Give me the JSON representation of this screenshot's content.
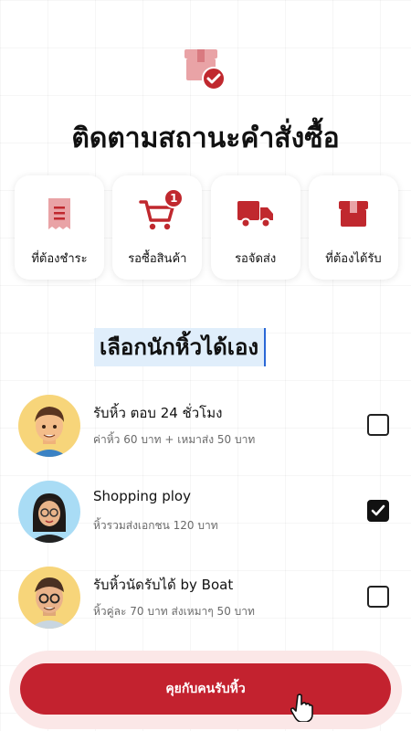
{
  "title": "ติดตามสถานะคำสั่งซื้อ",
  "status_cards": [
    {
      "label": "ที่ต้องชำระ",
      "icon": "receipt-icon"
    },
    {
      "label": "รอซื้อสินค้า",
      "icon": "shopping-cart-icon",
      "badge": "1"
    },
    {
      "label": "รอจัดส่ง",
      "icon": "delivery-truck-icon"
    },
    {
      "label": "ที่ต้องได้รับ",
      "icon": "package-box-icon"
    }
  ],
  "section_title": "เลือกนักหิ้วได้เอง",
  "couriers": [
    {
      "name": "รับหิ้ว ตอบ 24 ชั่วโมง",
      "desc": "ค่าหิ้ว 60 บาท + เหมาส่ง 50 บาท",
      "checked": false
    },
    {
      "name": "Shopping ploy",
      "desc": "หิ้วรวมส่งเอกชน 120 บาท",
      "checked": true
    },
    {
      "name": "รับหิ้วนัดรับได้ by Boat",
      "desc": "หิ้วคู่ละ 70 บาท ส่งเหมาๆ 50 บาท",
      "checked": false
    }
  ],
  "cta_label": "คุยกับคนรับหิ้ว",
  "colors": {
    "accent": "#c3222f",
    "icon_red": "#c0282e",
    "icon_pink": "#e9a3a6"
  }
}
